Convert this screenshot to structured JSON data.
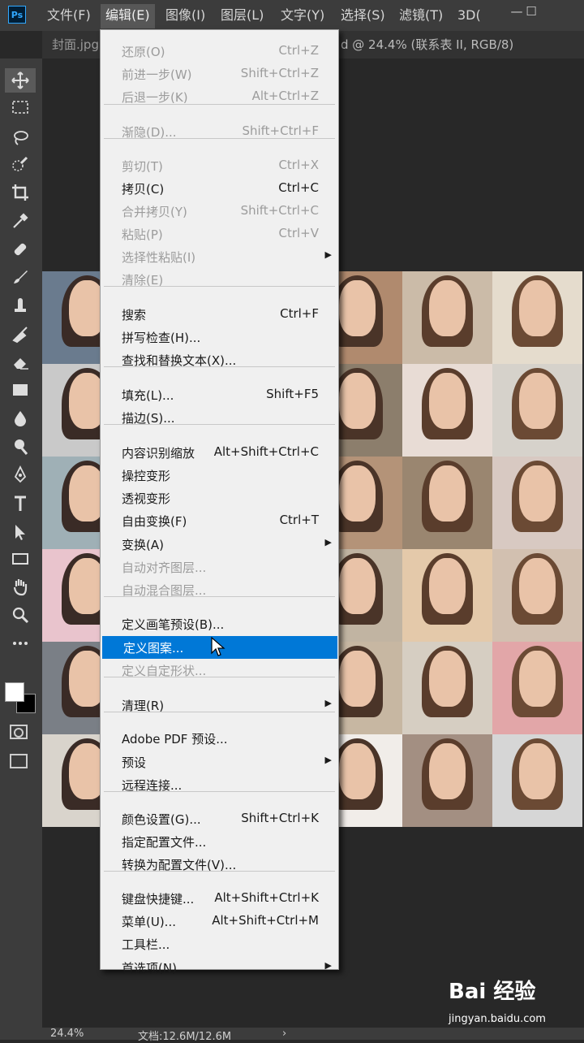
{
  "app": {
    "logo": "Ps"
  },
  "menubar": {
    "items": [
      {
        "label": "文件(F)"
      },
      {
        "label": "编辑(E)"
      },
      {
        "label": "图像(I)"
      },
      {
        "label": "图层(L)"
      },
      {
        "label": "文字(Y)"
      },
      {
        "label": "选择(S)"
      },
      {
        "label": "滤镜(T)"
      },
      {
        "label": "3D("
      }
    ],
    "active_index": 1,
    "window_controls": [
      "—",
      "☐"
    ]
  },
  "tabs": {
    "left": "封面.jpg",
    "right": "d @ 24.4% (联系表 II, RGB/8)"
  },
  "edit_menu": {
    "items": [
      {
        "label": "还原(O)",
        "shortcut": "Ctrl+Z",
        "enabled": false
      },
      {
        "label": "前进一步(W)",
        "shortcut": "Shift+Ctrl+Z",
        "enabled": false
      },
      {
        "label": "后退一步(K)",
        "shortcut": "Alt+Ctrl+Z",
        "enabled": false
      },
      {
        "sep": true
      },
      {
        "label": "渐隐(D)...",
        "shortcut": "Shift+Ctrl+F",
        "enabled": false
      },
      {
        "sep": true
      },
      {
        "label": "剪切(T)",
        "shortcut": "Ctrl+X",
        "enabled": false
      },
      {
        "label": "拷贝(C)",
        "shortcut": "Ctrl+C",
        "enabled": true
      },
      {
        "label": "合并拷贝(Y)",
        "shortcut": "Shift+Ctrl+C",
        "enabled": false
      },
      {
        "label": "粘贴(P)",
        "shortcut": "Ctrl+V",
        "enabled": false
      },
      {
        "label": "选择性粘贴(I)",
        "shortcut": "",
        "enabled": false,
        "submenu": true
      },
      {
        "label": "清除(E)",
        "shortcut": "",
        "enabled": false
      },
      {
        "sep": true
      },
      {
        "label": "搜索",
        "shortcut": "Ctrl+F",
        "enabled": true
      },
      {
        "label": "拼写检查(H)...",
        "shortcut": "",
        "enabled": true
      },
      {
        "label": "查找和替换文本(X)...",
        "shortcut": "",
        "enabled": true
      },
      {
        "sep": true
      },
      {
        "label": "填充(L)...",
        "shortcut": "Shift+F5",
        "enabled": true
      },
      {
        "label": "描边(S)...",
        "shortcut": "",
        "enabled": true
      },
      {
        "sep": true
      },
      {
        "label": "内容识别缩放",
        "shortcut": "Alt+Shift+Ctrl+C",
        "enabled": true
      },
      {
        "label": "操控变形",
        "shortcut": "",
        "enabled": true
      },
      {
        "label": "透视变形",
        "shortcut": "",
        "enabled": true
      },
      {
        "label": "自由变换(F)",
        "shortcut": "Ctrl+T",
        "enabled": true
      },
      {
        "label": "变换(A)",
        "shortcut": "",
        "enabled": true,
        "submenu": true
      },
      {
        "label": "自动对齐图层...",
        "shortcut": "",
        "enabled": false
      },
      {
        "label": "自动混合图层...",
        "shortcut": "",
        "enabled": false
      },
      {
        "sep": true
      },
      {
        "label": "定义画笔预设(B)...",
        "shortcut": "",
        "enabled": true
      },
      {
        "label": "定义图案...",
        "shortcut": "",
        "enabled": true,
        "highlighted": true
      },
      {
        "label": "定义自定形状...",
        "shortcut": "",
        "enabled": false
      },
      {
        "sep": true
      },
      {
        "label": "清理(R)",
        "shortcut": "",
        "enabled": true,
        "submenu": true
      },
      {
        "sep": true
      },
      {
        "label": "Adobe PDF 预设...",
        "shortcut": "",
        "enabled": true
      },
      {
        "label": "预设",
        "shortcut": "",
        "enabled": true,
        "submenu": true
      },
      {
        "label": "远程连接...",
        "shortcut": "",
        "enabled": true
      },
      {
        "sep": true
      },
      {
        "label": "颜色设置(G)...",
        "shortcut": "Shift+Ctrl+K",
        "enabled": true
      },
      {
        "label": "指定配置文件...",
        "shortcut": "",
        "enabled": true
      },
      {
        "label": "转换为配置文件(V)...",
        "shortcut": "",
        "enabled": true
      },
      {
        "sep": true
      },
      {
        "label": "键盘快捷键...",
        "shortcut": "Alt+Shift+Ctrl+K",
        "enabled": true
      },
      {
        "label": "菜单(U)...",
        "shortcut": "Alt+Shift+Ctrl+M",
        "enabled": true
      },
      {
        "label": "工具栏...",
        "shortcut": "",
        "enabled": true
      },
      {
        "label": "首选项(N)",
        "shortcut": "",
        "enabled": true,
        "submenu": true
      }
    ]
  },
  "tools": [
    "move-tool-icon",
    "marquee-tool-icon",
    "lasso-tool-icon",
    "quick-select-tool-icon",
    "crop-tool-icon",
    "eyedropper-tool-icon",
    "healing-brush-icon",
    "brush-tool-icon",
    "stamp-tool-icon",
    "history-brush-icon",
    "eraser-tool-icon",
    "gradient-tool-icon",
    "blur-tool-icon",
    "dodge-tool-icon",
    "pen-tool-icon",
    "type-tool-icon",
    "path-select-tool-icon",
    "rectangle-tool-icon",
    "hand-tool-icon",
    "zoom-tool-icon",
    "more-tools-icon"
  ],
  "statusbar": {
    "zoom": "24.4%",
    "doc_info": "文档:12.6M/12.6M",
    "nav_arrow": "›"
  },
  "watermark": {
    "brand": "Bai 经验",
    "url": "jingyan.baidu.com"
  },
  "colors": {
    "highlight": "#0078d7",
    "menu_bg": "#f0f0f0",
    "disabled_text": "#9c9c9c"
  }
}
